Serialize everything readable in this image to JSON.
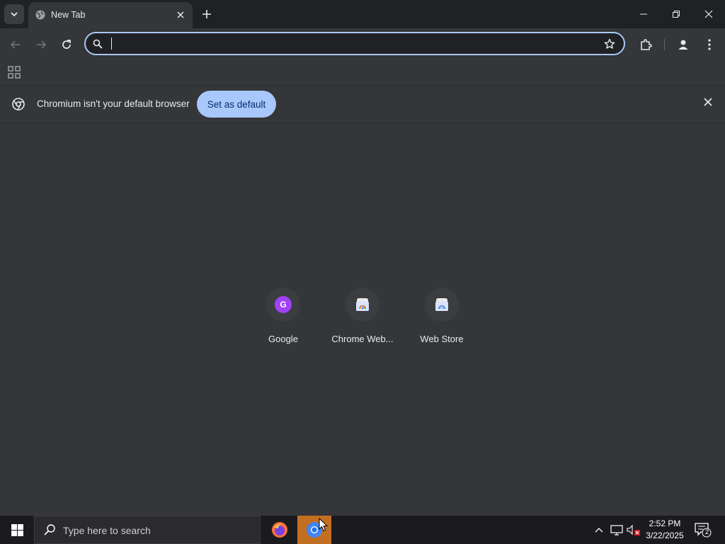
{
  "browser": {
    "tab": {
      "title": "New Tab"
    },
    "omnibox": {
      "value": "",
      "placeholder": ""
    },
    "infobar": {
      "message": "Chromium isn't your default browser",
      "button_label": "Set as default"
    },
    "shortcuts": [
      {
        "label": "Google",
        "icon": "google-g-icon",
        "letter": "G"
      },
      {
        "label": "Chrome Web...",
        "icon": "chrome-web-store-icon"
      },
      {
        "label": "Web Store",
        "icon": "web-store-icon"
      }
    ]
  },
  "taskbar": {
    "search_placeholder": "Type here to search",
    "clock": {
      "time": "2:52 PM",
      "date": "3/22/2025"
    },
    "notification_count": "2"
  },
  "colors": {
    "accent": "#a8c7fa",
    "taskbar_active": "#c36f21"
  }
}
